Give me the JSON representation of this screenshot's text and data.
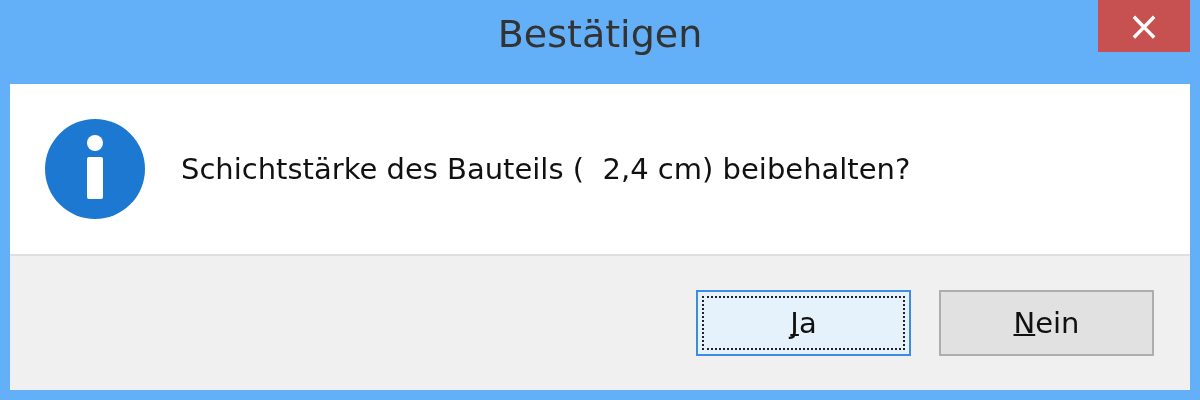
{
  "window": {
    "title": "Bestätigen",
    "close_button": "×"
  },
  "message": {
    "kind": "info",
    "text": "Schichtstärke des Bauteils (  2,4 cm) beibehalten?"
  },
  "buttons": [
    {
      "access_key": "J",
      "label_rest": "a",
      "focused": true
    },
    {
      "access_key": "N",
      "label_rest": "ein",
      "focused": false
    }
  ]
}
